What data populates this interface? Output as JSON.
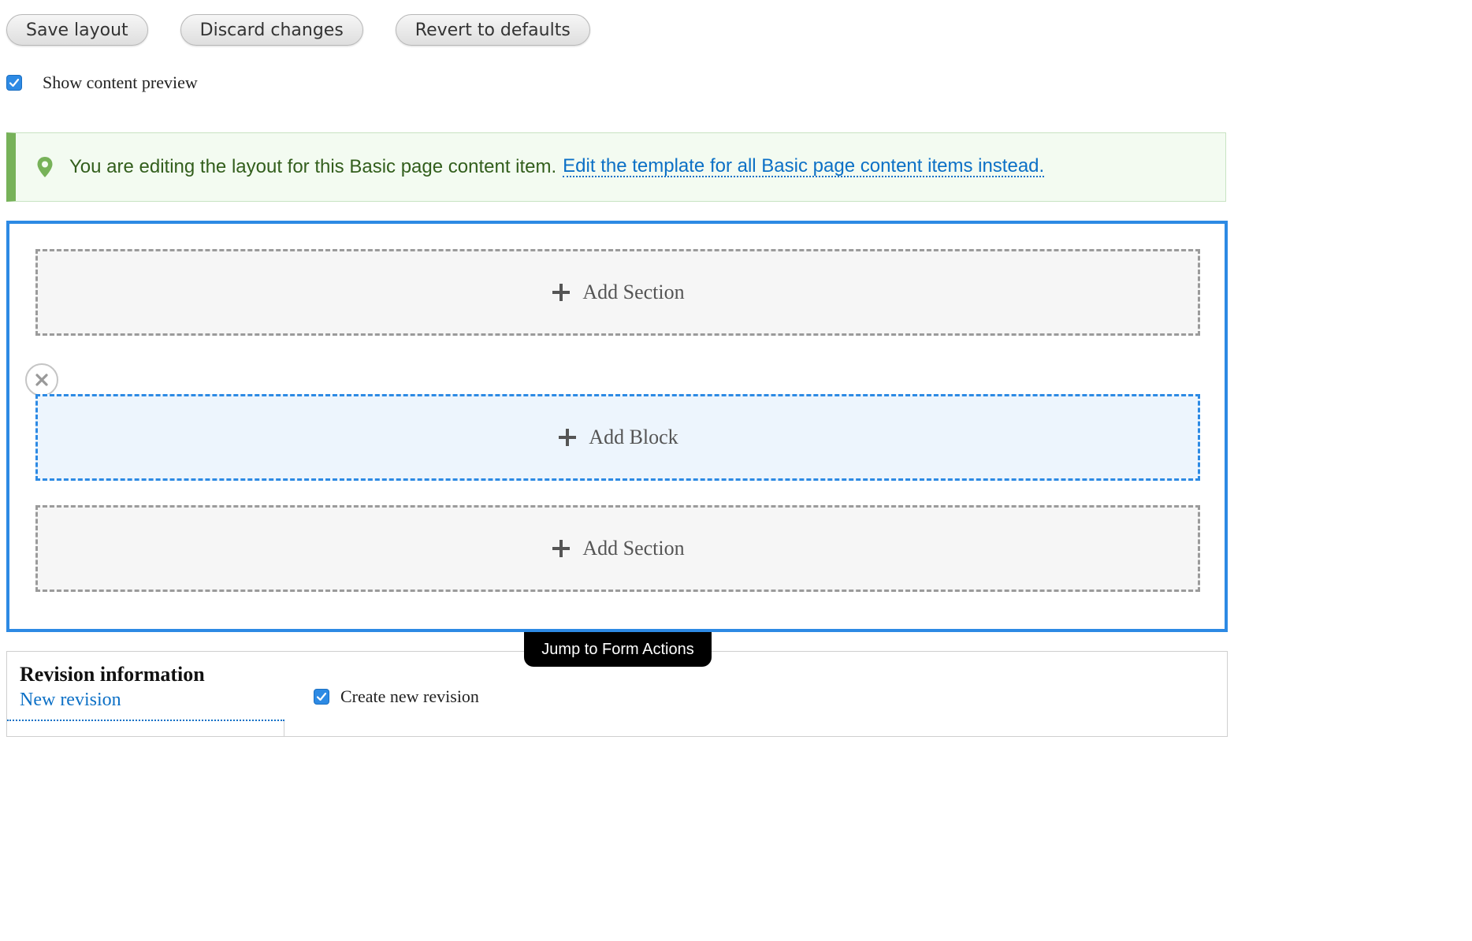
{
  "toolbar": {
    "save_label": "Save layout",
    "discard_label": "Discard changes",
    "revert_label": "Revert to defaults"
  },
  "preview": {
    "label": "Show content preview",
    "checked": true
  },
  "status": {
    "message": "You are editing the layout for this Basic page content item.",
    "link": "Edit the template for all Basic page content items instead."
  },
  "builder": {
    "add_section_top": "Add Section",
    "add_block": "Add Block",
    "add_section_bottom": "Add Section"
  },
  "jump_link": "Jump to Form Actions",
  "revision": {
    "title": "Revision information",
    "summary": "New revision",
    "checkbox_label": "Create new revision",
    "checked": true
  },
  "colors": {
    "accent": "#2d8ae4",
    "status_green": "#77b259",
    "link_blue": "#0c70c6"
  }
}
